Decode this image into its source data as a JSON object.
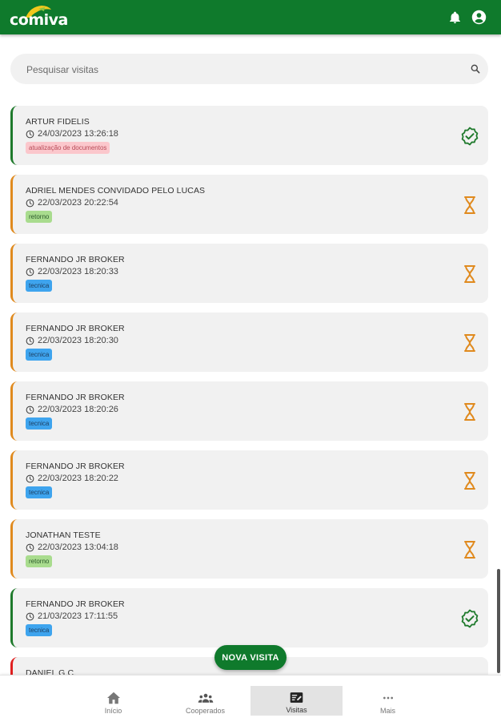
{
  "app": {
    "brand": "comiva",
    "accent": "#0f7a2c"
  },
  "header": {
    "notifications_icon": "bell-icon",
    "account_icon": "account-circle-icon"
  },
  "search": {
    "placeholder": "Pesquisar visitas"
  },
  "visits": [
    {
      "name": "ARTUR FIDELIS",
      "datetime": "24/03/2023 13:26:18",
      "tag": "atualização de documentos",
      "tag_color": "pink",
      "status": "done"
    },
    {
      "name": "ADRIEL MENDES CONVIDADO PELO LUCAS",
      "datetime": "22/03/2023 20:22:54",
      "tag": "retorno",
      "tag_color": "green",
      "status": "pending"
    },
    {
      "name": "FERNANDO JR BROKER",
      "datetime": "22/03/2023 18:20:33",
      "tag": "tecnica",
      "tag_color": "blue",
      "status": "pending"
    },
    {
      "name": "FERNANDO JR BROKER",
      "datetime": "22/03/2023 18:20:30",
      "tag": "tecnica",
      "tag_color": "blue",
      "status": "pending"
    },
    {
      "name": "FERNANDO JR BROKER",
      "datetime": "22/03/2023 18:20:26",
      "tag": "tecnica",
      "tag_color": "blue",
      "status": "pending"
    },
    {
      "name": "FERNANDO JR BROKER",
      "datetime": "22/03/2023 18:20:22",
      "tag": "tecnica",
      "tag_color": "blue",
      "status": "pending"
    },
    {
      "name": "JONATHAN TESTE",
      "datetime": "22/03/2023 13:04:18",
      "tag": "retorno",
      "tag_color": "green",
      "status": "pending"
    },
    {
      "name": "FERNANDO JR BROKER",
      "datetime": "21/03/2023 17:11:55",
      "tag": "tecnica",
      "tag_color": "blue",
      "status": "done"
    },
    {
      "name": "DANIEL G.C.",
      "datetime": "",
      "tag": "",
      "tag_color": "",
      "status": "red"
    }
  ],
  "fab": {
    "label": "NOVA VISITA"
  },
  "bottom_nav": [
    {
      "label": "Início",
      "icon": "home-icon",
      "active": false
    },
    {
      "label": "Cooperados",
      "icon": "people-icon",
      "active": false
    },
    {
      "label": "Visitas",
      "icon": "visits-icon",
      "active": true
    },
    {
      "label": "Mais",
      "icon": "more-icon",
      "active": false
    }
  ],
  "status_colors": {
    "done": "#1f7a2c",
    "pending": "#e08a1e",
    "red": "#e02020"
  }
}
